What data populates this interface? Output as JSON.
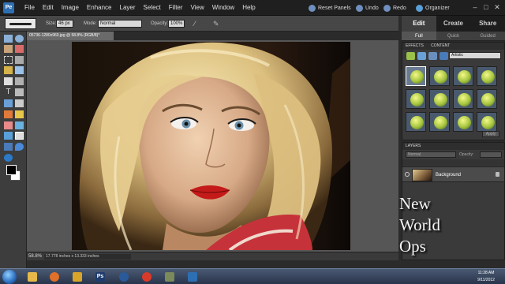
{
  "menubar": {
    "items": [
      "File",
      "Edit",
      "Image",
      "Enhance",
      "Layer",
      "Select",
      "Filter",
      "View",
      "Window",
      "Help"
    ],
    "reset_panels": "Reset Panels",
    "undo": "Undo",
    "redo": "Redo",
    "organizer": "Organizer"
  },
  "options": {
    "size_label": "Size:",
    "size_value": "46 px",
    "mode_label": "Mode:",
    "mode_value": "Normal",
    "opacity_label": "Opacity:",
    "opacity_value": "100%"
  },
  "panel": {
    "tabs": [
      "Edit",
      "Create",
      "Share"
    ],
    "subtabs": [
      "Full",
      "Quick",
      "Guided"
    ]
  },
  "document": {
    "tab_title": "05736-1280x960.jpg @ 58.8% (RGB/8)*",
    "zoom": "58.8%",
    "info": "17.778 inches x 13.333 inches"
  },
  "effects": {
    "tabs": [
      "EFFECTS",
      "CONTENT"
    ],
    "filter_value": "Artistic",
    "apply_label": "Apply"
  },
  "layers": {
    "title": "LAYERS",
    "blend_mode": "Normal",
    "opacity_label": "Opacity:",
    "layer_name": "Background"
  },
  "watermark": {
    "line1": "New",
    "line2": "World",
    "line3": "Ops"
  },
  "taskbar": {
    "time": "11:28 AM",
    "date": "9/11/2012"
  },
  "colors": {
    "accent": "#2d6fb3",
    "panel_bg": "#3a3a3a",
    "canvas_bg": "#565656"
  }
}
